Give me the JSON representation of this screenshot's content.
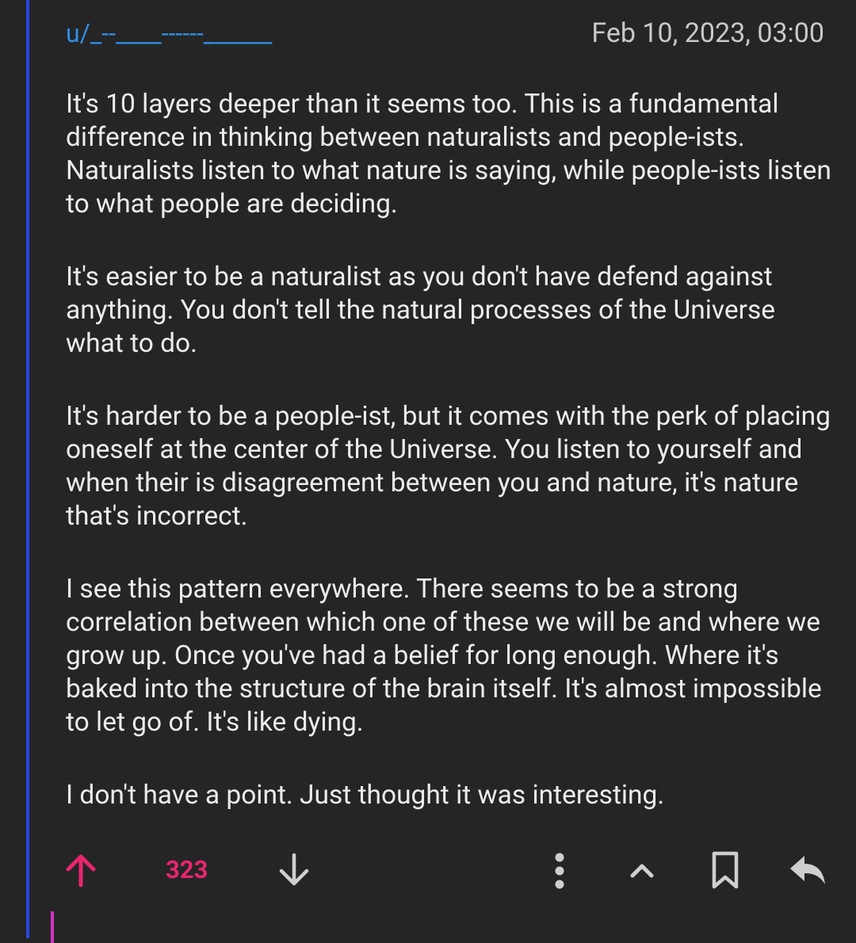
{
  "comment": {
    "username": "u/_--____------______",
    "timestamp": "Feb 10, 2023, 03:00",
    "paragraphs": [
      "It's 10 layers deeper than it seems too. This is a fundamental difference in thinking between naturalists and people-ists. Naturalists listen to what nature is saying, while people-ists listen to what people are deciding.",
      "It's easier to be a naturalist as you don't have defend against anything. You don't tell the natural processes of the Universe what to do.",
      "It's harder to be a people-ist, but it comes with the perk of placing oneself at the center of the Universe. You listen to yourself and when their is disagreement between you and nature, it's nature that's incorrect.",
      "I see this pattern everywhere. There seems to be a strong correlation between which one of these we will be and where we grow up. Once you've had a belief for long enough. Where it's baked into the structure of the brain itself. It's almost impossible to let go of. It's like dying.",
      "I don't have a point.  Just thought it was interesting."
    ],
    "score": "323",
    "actions": {
      "upvote_icon": "arrow-up-icon",
      "downvote_icon": "arrow-down-icon",
      "more_icon": "more-vertical-icon",
      "collapse_icon": "chevron-up-icon",
      "save_icon": "bookmark-icon",
      "reply_icon": "reply-icon"
    }
  },
  "colors": {
    "background": "#252526",
    "thread_line": "#2b47e0",
    "nested_thread_line": "#d52fc7",
    "username": "#2f8fe3",
    "upvoted": "#e8256f",
    "text": "#ececec",
    "muted": "#c9c9c9"
  }
}
